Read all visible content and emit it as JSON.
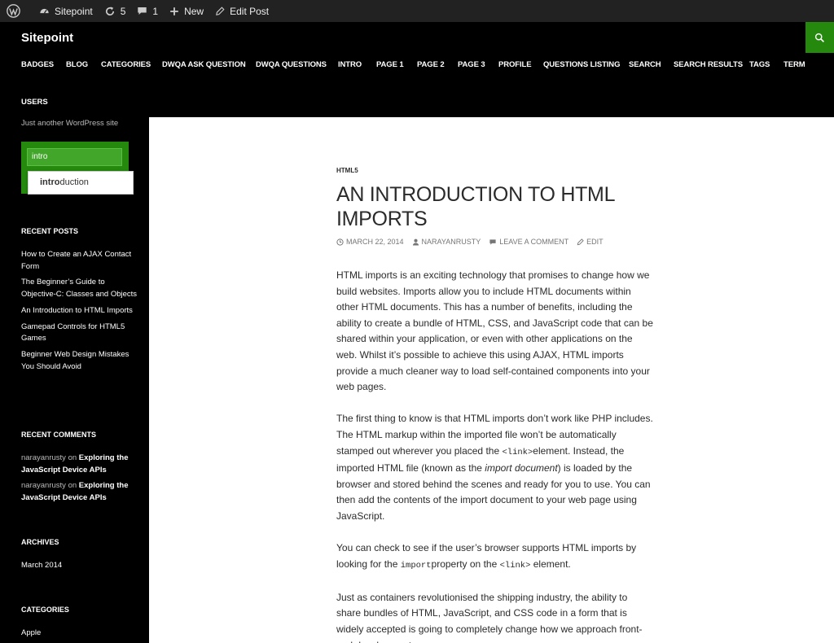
{
  "admin_bar": {
    "site_name": "Sitepoint",
    "updates_count": "5",
    "comments_count": "1",
    "new_label": "New",
    "edit_post_label": "Edit Post"
  },
  "header": {
    "site_title": "Sitepoint",
    "accent_color": "#24890d",
    "nav": [
      "BADGES",
      "BLOG",
      "CATEGORIES",
      "DWQA ASK QUESTION",
      "DWQA QUESTIONS",
      "INTRO",
      "PAGE 1",
      "PAGE 2",
      "PAGE 3",
      "PROFILE",
      "QUESTIONS LISTING",
      "SEARCH",
      "SEARCH RESULTS",
      "TAGS",
      "TERM"
    ],
    "nav_overflow": "USERS"
  },
  "sidebar": {
    "tagline": "Just another WordPress site",
    "search_value": "intro",
    "autocomplete_prefix": "intro",
    "autocomplete_rest": "duction",
    "recent_posts": {
      "title": "RECENT POSTS",
      "items": [
        "How to Create an AJAX Contact Form",
        "The Beginner’s Guide to Objective-C: Classes and Objects",
        "An Introduction to HTML Imports",
        "Gamepad Controls for HTML5 Games",
        "Beginner Web Design Mistakes You Should Avoid"
      ]
    },
    "recent_comments": {
      "title": "RECENT COMMENTS",
      "items": [
        {
          "author": "narayanrusty",
          "on": "on",
          "post": "Exploring the JavaScript Device APIs"
        },
        {
          "author": "narayanrusty",
          "on": "on",
          "post": "Exploring the JavaScript Device APIs"
        }
      ]
    },
    "archives": {
      "title": "ARCHIVES",
      "items": [
        "March 2014"
      ]
    },
    "categories": {
      "title": "CATEGORIES",
      "items": [
        "Apple"
      ]
    }
  },
  "post": {
    "category": "HTML5",
    "title": "AN INTRODUCTION TO HTML IMPORTS",
    "date": "MARCH 22, 2014",
    "author": "NARAYANRUSTY",
    "comment_link": "LEAVE A COMMENT",
    "edit_link": "EDIT",
    "p1": "HTML imports is an exciting technology that promises to change how we build websites. Imports allow you to include HTML documents within other HTML documents. This has a number of benefits, including the ability to create a bundle of HTML, CSS, and JavaScript code that can be shared within your application, or even with other applications on the web. Whilst it’s possible to achieve this using AJAX, HTML imports provide a much cleaner way to load self-contained components into your web pages.",
    "p2_a": "The first thing to know is that HTML imports don’t work like PHP includes. The HTML markup within the imported file won’t be automatically stamped out wherever you placed the ",
    "p2_code": "<link>",
    "p2_b": "element. Instead, the imported HTML file (known as the ",
    "p2_em": "import document",
    "p2_c": ") is loaded by the browser and stored behind the scenes and ready for you to use. You can then add the contents of the import document to your web page using JavaScript.",
    "p3_a": "You can check to see if the user’s browser supports HTML imports by looking for the ",
    "p3_code1": "import",
    "p3_b": "property on the ",
    "p3_code2": "<link>",
    "p3_c": " element.",
    "p4": "Just as containers revolutionised the shipping industry, the ability to share bundles of HTML, JavaScript, and CSS code in a form that is widely accepted is going to completely change how we approach front-end development."
  }
}
